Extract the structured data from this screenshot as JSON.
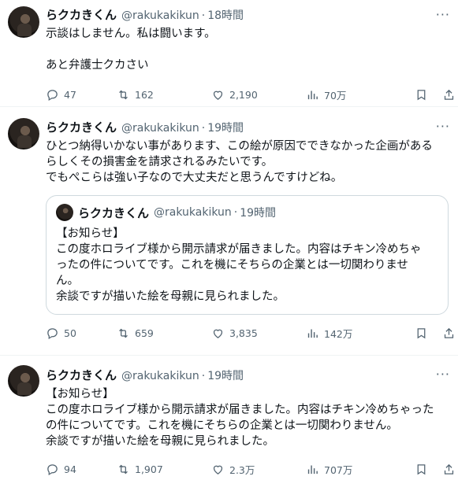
{
  "tweets": [
    {
      "name": "らクカきくん",
      "handle": "@rakukakikun",
      "time": "18時間",
      "text": "示談はしません。私は闘います。\n\nあと弁護士クカさい",
      "replies": "47",
      "retweets": "162",
      "likes": "2,190",
      "views": "70万"
    },
    {
      "name": "らクカきくん",
      "handle": "@rakukakikun",
      "time": "19時間",
      "text": "ひとつ納得いかない事があります、この絵が原因でできなかった企画がある\nらしくその損害金を請求されるみたいです。\nでもぺこらは強い子なので大丈夫だと思うんですけどね。",
      "quote": {
        "name": "らクカきくん",
        "handle": "@rakukakikun",
        "time": "19時間",
        "text": "【お知らせ】\nこの度ホロライブ様から開示請求が届きました。内容はチキン冷めちゃ\nったの件についてです。これを機にそちらの企業とは一切関わりませ\nん。\n余談ですが描いた絵を母親に見られました。"
      },
      "replies": "50",
      "retweets": "659",
      "likes": "3,835",
      "views": "142万"
    },
    {
      "name": "らクカきくん",
      "handle": "@rakukakikun",
      "time": "19時間",
      "text": "【お知らせ】\nこの度ホロライブ様から開示請求が届きました。内容はチキン冷めちゃった\nの件についてです。これを機にそちらの企業とは一切関わりません。\n余談ですが描いた絵を母親に見られました。",
      "replies": "94",
      "retweets": "1,907",
      "likes": "2.3万",
      "views": "707万"
    }
  ],
  "separator": "·",
  "icons": [
    "more-icon",
    "reply-icon",
    "retweet-icon",
    "like-icon",
    "views-icon",
    "bookmark-icon",
    "share-icon"
  ],
  "colors": {
    "text": "#0f1419",
    "secondary": "#536471",
    "border": "#cfd9de",
    "divider": "#eff3f4"
  }
}
